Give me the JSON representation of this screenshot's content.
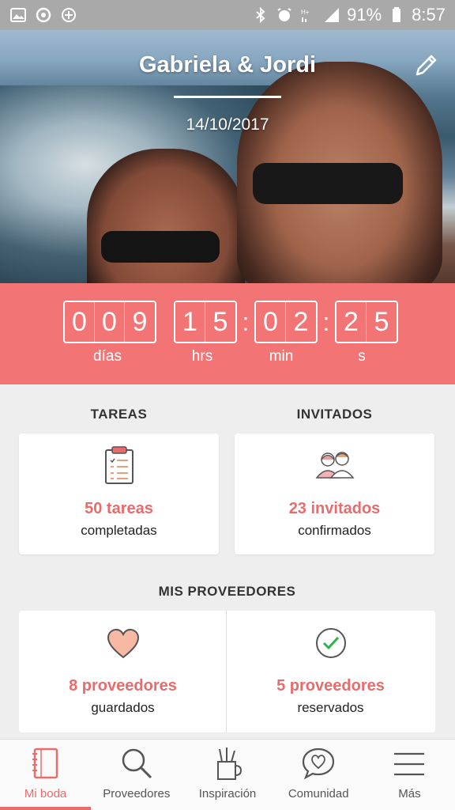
{
  "status_bar": {
    "battery": "91%",
    "time": "8:57"
  },
  "hero": {
    "names": "Gabriela & Jordi",
    "date": "14/10/2017"
  },
  "countdown": {
    "days": [
      "0",
      "0",
      "9"
    ],
    "hours": [
      "1",
      "5"
    ],
    "minutes": [
      "0",
      "2"
    ],
    "seconds": [
      "2",
      "5"
    ],
    "labels": {
      "days": "días",
      "hours": "hrs",
      "minutes": "min",
      "seconds": "s"
    }
  },
  "tasks": {
    "title": "TAREAS",
    "count": "50 tareas",
    "sub": "completadas"
  },
  "guests": {
    "title": "INVITADOS",
    "count": "23 invitados",
    "sub": "confirmados"
  },
  "providers": {
    "title": "MIS PROVEEDORES",
    "saved": {
      "count": "8 proveedores",
      "sub": "guardados"
    },
    "booked": {
      "count": "5 proveedores",
      "sub": "reservados"
    }
  },
  "nav": {
    "items": [
      {
        "label": "Mi boda",
        "icon": "notebook-icon"
      },
      {
        "label": "Proveedores",
        "icon": "search-icon"
      },
      {
        "label": "Inspiración",
        "icon": "pencil-cup-icon"
      },
      {
        "label": "Comunidad",
        "icon": "chat-heart-icon"
      },
      {
        "label": "Más",
        "icon": "menu-icon"
      }
    ],
    "active": "Mi boda"
  },
  "colors": {
    "accent": "#f27474",
    "accent_text": "#e86c6c",
    "background": "#eeeeee"
  }
}
